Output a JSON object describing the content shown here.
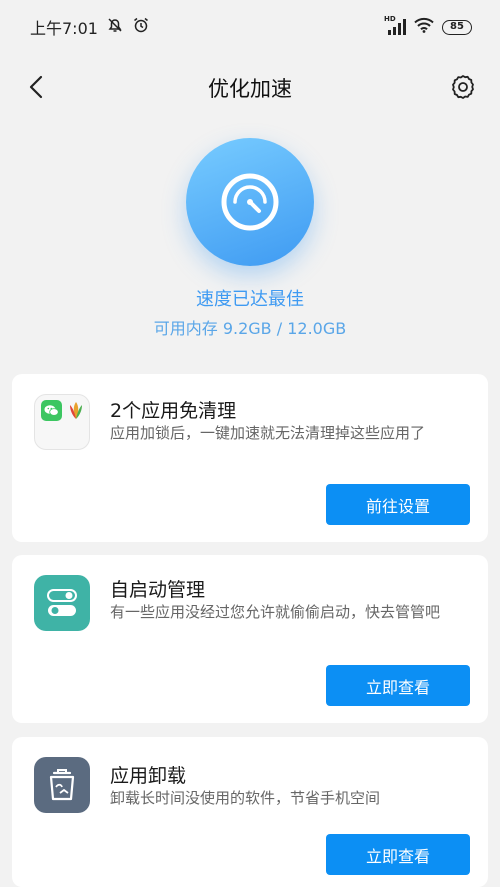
{
  "status_bar": {
    "time": "上午7:01",
    "battery": "85",
    "network_label": "HD"
  },
  "header": {
    "title": "优化加速"
  },
  "hero": {
    "status_text": "速度已达最佳",
    "memory_text": "可用内存 9.2GB / 12.0GB",
    "icon": "speedometer-icon"
  },
  "cards": [
    {
      "title": "2个应用免清理",
      "description": "应用加锁后，一键加速就无法清理掉这些应用了",
      "button": "前往设置",
      "icon": "locked-apps-icon"
    },
    {
      "title": "自启动管理",
      "description": "有一些应用没经过您允许就偷偷启动，快去管管吧",
      "button": "立即查看",
      "icon": "toggle-switch-icon"
    },
    {
      "title": "应用卸载",
      "description": "卸载长时间没使用的软件，节省手机空间",
      "button": "立即查看",
      "icon": "trash-icon"
    }
  ],
  "colors": {
    "accent": "#0c8ff4",
    "hero_blue": "#3e9af2",
    "teal": "#3fb3a6",
    "slate": "#5b6b80"
  }
}
